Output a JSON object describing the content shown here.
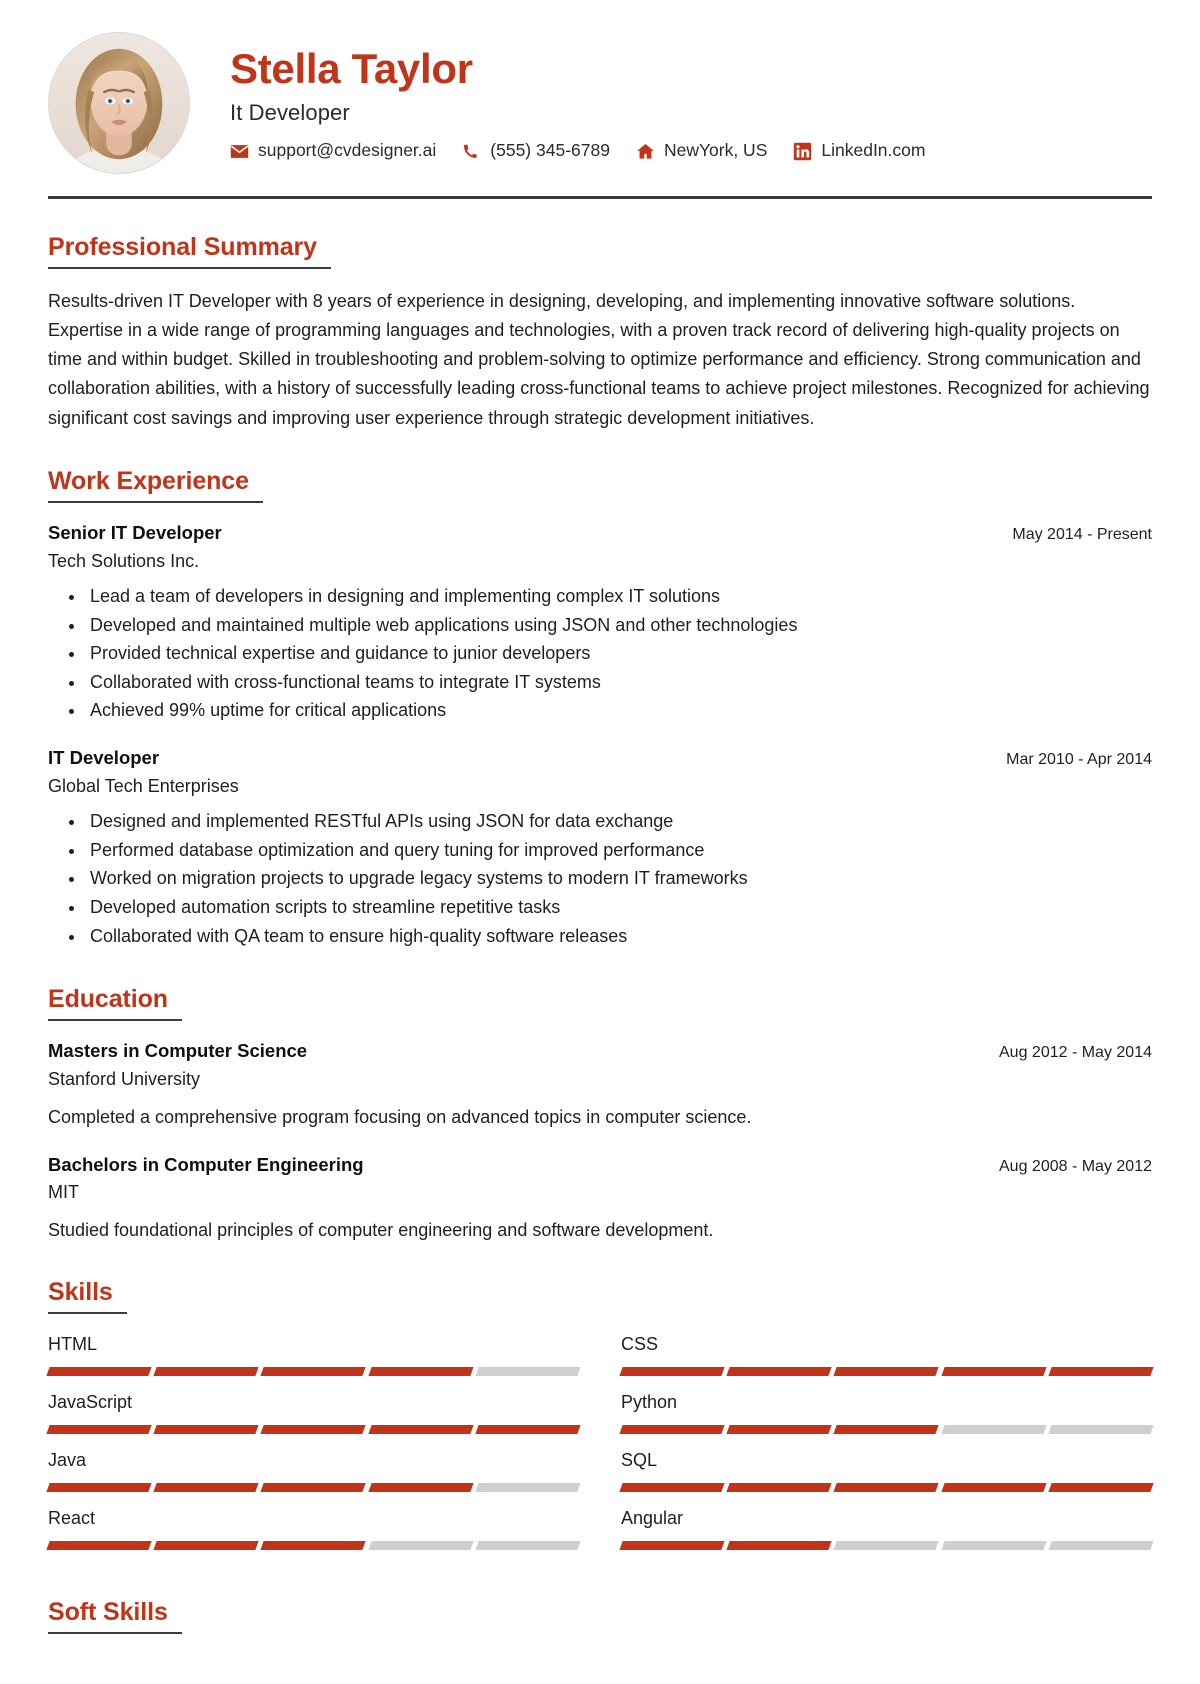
{
  "header": {
    "name": "Stella Taylor",
    "job_title": "It Developer",
    "avatar_alt": "profile-photo",
    "contacts": [
      {
        "icon": "email-icon",
        "text": "support@cvdesigner.ai"
      },
      {
        "icon": "phone-icon",
        "text": "(555) 345-6789"
      },
      {
        "icon": "home-icon",
        "text": "NewYork, US"
      },
      {
        "icon": "linkedin-icon",
        "text": "LinkedIn.com"
      }
    ]
  },
  "sections": {
    "summary": {
      "heading": "Professional Summary",
      "text": "Results-driven IT Developer with 8 years of experience in designing, developing, and implementing innovative software solutions. Expertise in a wide range of programming languages and technologies, with a proven track record of delivering high-quality projects on time and within budget. Skilled in troubleshooting and problem-solving to optimize performance and efficiency. Strong communication and collaboration abilities, with a history of successfully leading cross-functional teams to achieve project milestones. Recognized for achieving significant cost savings and improving user experience through strategic development initiatives."
    },
    "work": {
      "heading": "Work Experience",
      "entries": [
        {
          "role": "Senior IT Developer",
          "org": "Tech Solutions Inc.",
          "date": "May 2014 - Present",
          "bullets": [
            "Lead a team of developers in designing and implementing complex IT solutions",
            "Developed and maintained multiple web applications using JSON and other technologies",
            "Provided technical expertise and guidance to junior developers",
            "Collaborated with cross-functional teams to integrate IT systems",
            "Achieved 99% uptime for critical applications"
          ]
        },
        {
          "role": "IT Developer",
          "org": "Global Tech Enterprises",
          "date": "Mar 2010 - Apr 2014",
          "bullets": [
            "Designed and implemented RESTful APIs using JSON for data exchange",
            "Performed database optimization and query tuning for improved performance",
            "Worked on migration projects to upgrade legacy systems to modern IT frameworks",
            "Developed automation scripts to streamline repetitive tasks",
            "Collaborated with QA team to ensure high-quality software releases"
          ]
        }
      ]
    },
    "education": {
      "heading": "Education",
      "entries": [
        {
          "role": "Masters in Computer Science",
          "org": "Stanford University",
          "date": "Aug 2012 - May 2014",
          "desc": "Completed a comprehensive program focusing on advanced topics in computer science."
        },
        {
          "role": "Bachelors in Computer Engineering",
          "org": "MIT",
          "date": "Aug 2008 - May 2012",
          "desc": "Studied foundational principles of computer engineering and software development."
        }
      ]
    },
    "skills": {
      "heading": "Skills",
      "max_level": 5,
      "items": [
        {
          "name": "HTML",
          "level": 4
        },
        {
          "name": "CSS",
          "level": 5
        },
        {
          "name": "JavaScript",
          "level": 5
        },
        {
          "name": "Python",
          "level": 3
        },
        {
          "name": "Java",
          "level": 4
        },
        {
          "name": "SQL",
          "level": 5
        },
        {
          "name": "React",
          "level": 3
        },
        {
          "name": "Angular",
          "level": 2
        }
      ]
    },
    "soft_skills": {
      "heading": "Soft Skills"
    }
  },
  "colors": {
    "accent": "#c0351a",
    "rule": "#3c3c3c",
    "bar_empty": "#cfcfcf",
    "text": "#1f1f1f"
  }
}
